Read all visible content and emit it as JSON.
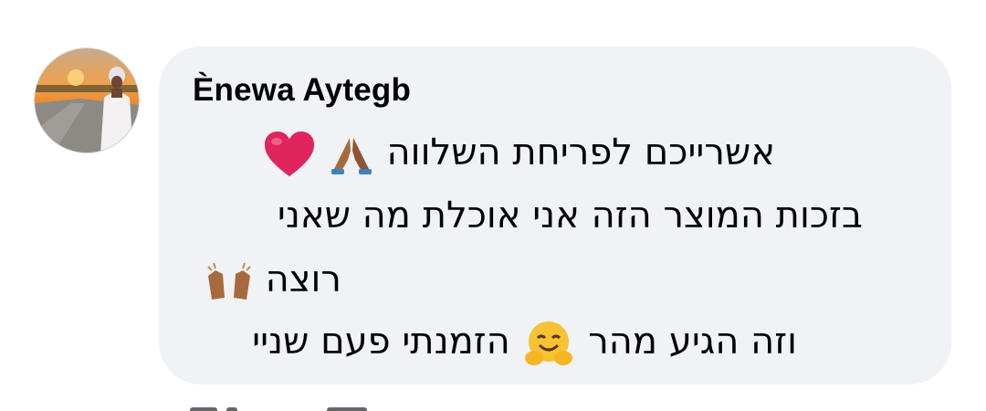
{
  "comment": {
    "author": "Ènewa Aytegb",
    "lines": [
      "אשרייכם  לפריחת השלווה",
      "בזכות המוצר הזה אני אוכלת מה שאני",
      "רוצה",
      "הזמנתי פעם שניי",
      "וזה הגיע מהר"
    ],
    "emojis": {
      "line1": [
        "heart-emoji",
        "folded-hands-emoji"
      ],
      "line3": [
        "raising-hands-emoji"
      ],
      "line4": [
        "hugging-face-emoji"
      ]
    }
  },
  "colors": {
    "bubble": "#f0f2f5",
    "text": "#050505",
    "heart": "#e0245e",
    "skin": "#a86a3d"
  }
}
